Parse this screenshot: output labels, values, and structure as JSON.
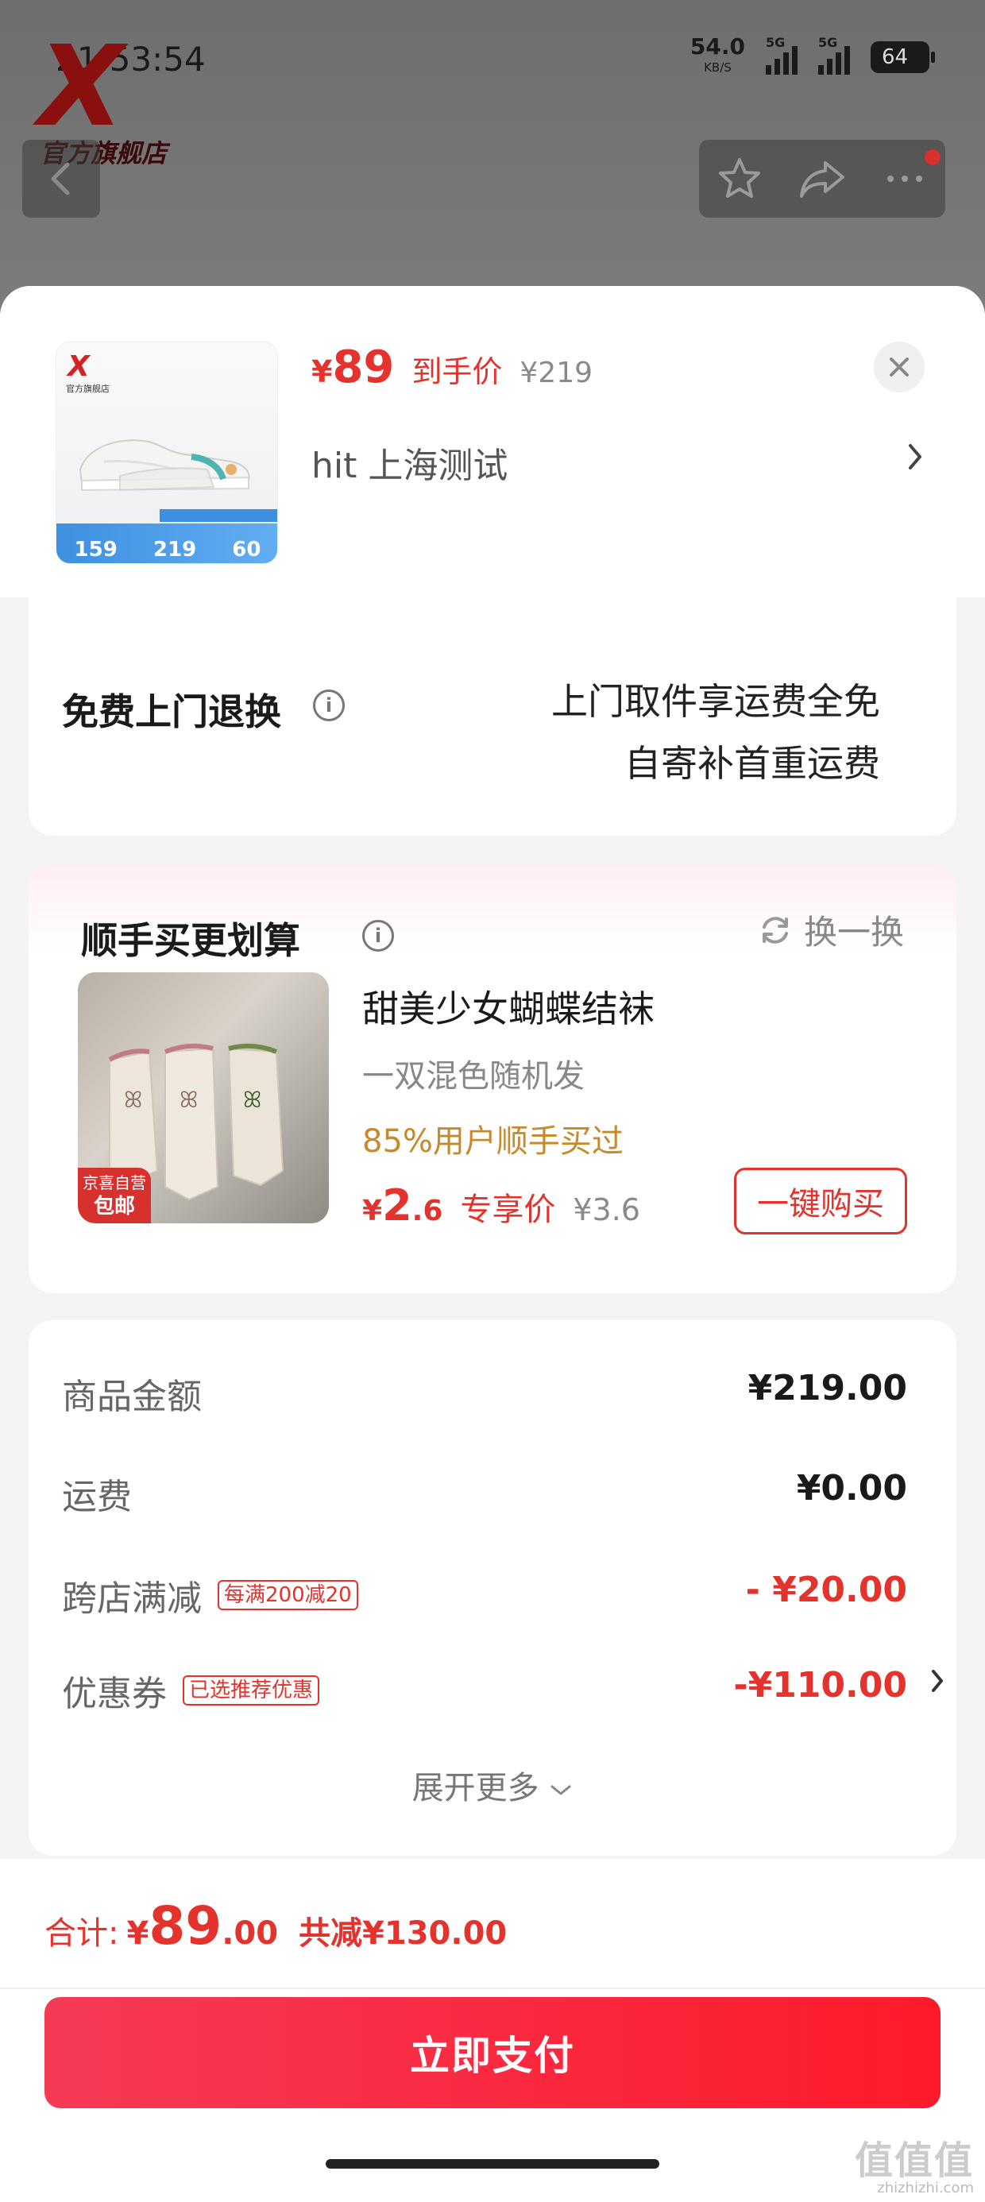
{
  "status_bar": {
    "time": "21:53:54",
    "speed_value": "54.0",
    "speed_unit": "KB/S",
    "network_1": "5G",
    "network_2": "5G",
    "battery": "64"
  },
  "store": {
    "logo_mark": "X",
    "logo_text": "官方旗舰店"
  },
  "product": {
    "thumb_logo": "X",
    "thumb_logo_sub": "官方旗舰店",
    "thumb_band_values": [
      "159",
      "219",
      "60"
    ],
    "final_price_symbol": "¥",
    "final_price": "89",
    "final_price_tag": "到手价",
    "original_price": "¥219",
    "spec": "hit  上海测试"
  },
  "return_service": {
    "title": "免费上门退换",
    "line1": "上门取件享运费全免",
    "line2": "自寄补首重运费"
  },
  "bundle": {
    "title": "顺手买更划算",
    "swap_label": "换一换",
    "badge_line1": "京喜自营",
    "badge_line2": "包邮",
    "name": "甜美少女蝴蝶结袜",
    "desc": "一双混色随机发",
    "stat": "85%用户顺手买过",
    "price_symbol": "¥",
    "price_int": "2",
    "price_dec": ".6",
    "price_tag": "专享价",
    "original_price": "¥3.6",
    "buy_label": "一键购买"
  },
  "summary": {
    "rows": [
      {
        "label": "商品金额",
        "badge": "",
        "value": "¥219.00"
      },
      {
        "label": "运费",
        "badge": "",
        "value": "¥0.00"
      },
      {
        "label": "跨店满减",
        "badge": "每满200减20",
        "value": "- ¥20.00"
      },
      {
        "label": "优惠券",
        "badge": "已选推荐优惠",
        "value": "-¥110.00"
      }
    ],
    "expand_label": "展开更多"
  },
  "footer": {
    "total_label": "合计:",
    "total_symbol": "¥",
    "total_int": "89",
    "total_dec": ".00",
    "total_saved": "共减¥130.00",
    "pay_label": "立即支付"
  },
  "watermark": {
    "big": "值值值",
    "small": "zhizhizhi.com"
  },
  "colors": {
    "accent_red": "#e4322c",
    "pay_gradient_start": "#f53a56",
    "pay_gradient_end": "#fe1a2b",
    "highlight_gold": "#c7892a"
  }
}
